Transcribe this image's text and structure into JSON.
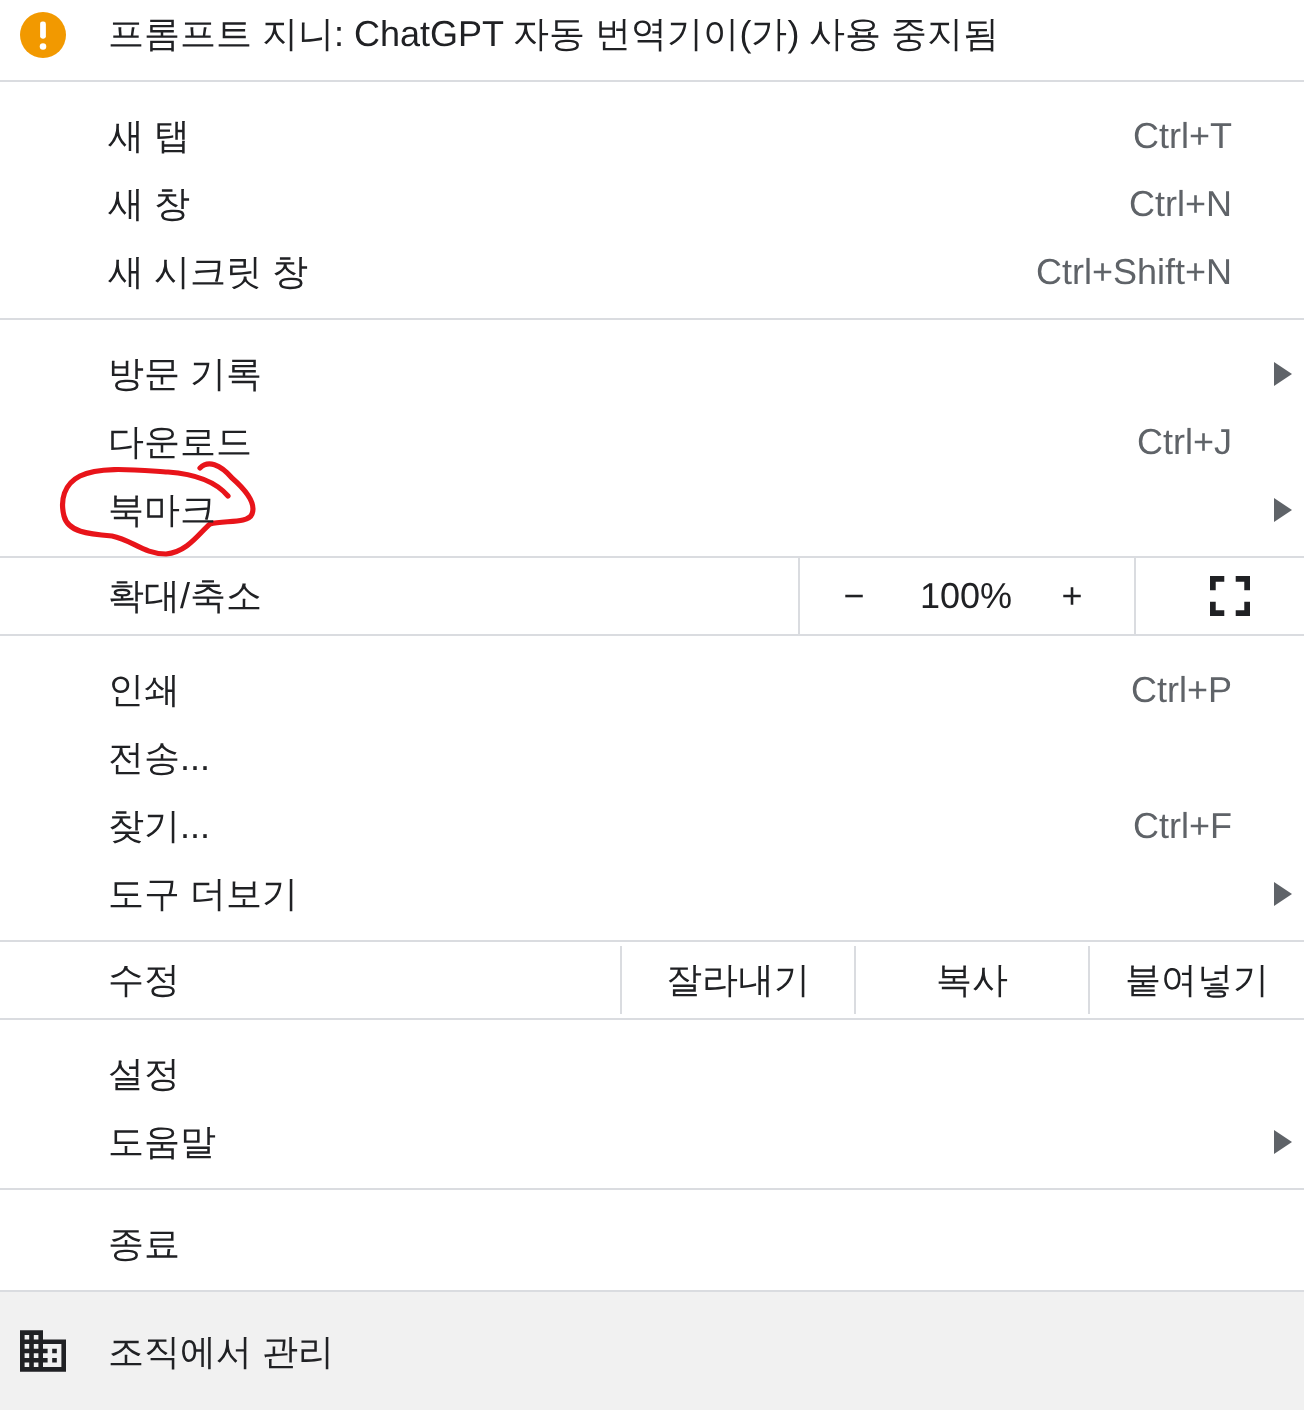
{
  "warning": {
    "text": "프롬프트 지니: ChatGPT 자동 번역기이(가) 사용 중지됨"
  },
  "sections": [
    {
      "kind": "list",
      "items": [
        {
          "label": "새 탭",
          "shortcut": "Ctrl+T",
          "submenu": false,
          "circled": false
        },
        {
          "label": "새 창",
          "shortcut": "Ctrl+N",
          "submenu": false,
          "circled": false
        },
        {
          "label": "새 시크릿 창",
          "shortcut": "Ctrl+Shift+N",
          "submenu": false,
          "circled": false
        }
      ]
    },
    {
      "kind": "list",
      "items": [
        {
          "label": "방문 기록",
          "submenu": true,
          "circled": false
        },
        {
          "label": "다운로드",
          "shortcut": "Ctrl+J",
          "submenu": false,
          "circled": false
        },
        {
          "label": "북마크",
          "submenu": true,
          "circled": true
        }
      ]
    },
    {
      "kind": "zoom",
      "label": "확대/축소",
      "decrease": "−",
      "zoom_level": "100%",
      "increase": "+"
    },
    {
      "kind": "list",
      "items": [
        {
          "label": "인쇄",
          "shortcut": "Ctrl+P",
          "submenu": false,
          "circled": false
        },
        {
          "label": "전송...",
          "submenu": false,
          "circled": false
        },
        {
          "label": "찾기...",
          "shortcut": "Ctrl+F",
          "submenu": false,
          "circled": false
        },
        {
          "label": "도구 더보기",
          "submenu": true,
          "circled": false
        }
      ]
    },
    {
      "kind": "edit",
      "label": "수정",
      "actions": [
        "잘라내기",
        "복사",
        "붙여넣기"
      ]
    },
    {
      "kind": "list",
      "items": [
        {
          "label": "설정",
          "submenu": false,
          "circled": false
        },
        {
          "label": "도움말",
          "submenu": true,
          "circled": false
        }
      ]
    },
    {
      "kind": "list",
      "items": [
        {
          "label": "종료",
          "submenu": false,
          "circled": false
        }
      ]
    }
  ],
  "footer": {
    "text": "조직에서 관리"
  }
}
